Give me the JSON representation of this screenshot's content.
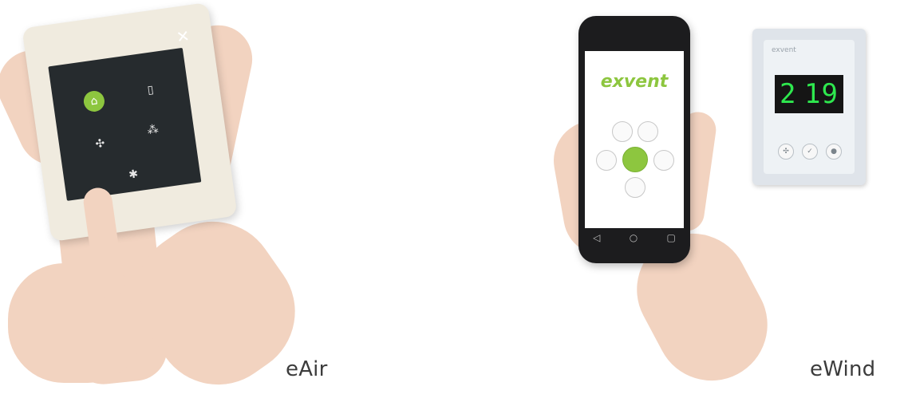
{
  "captions": {
    "left": "eAir",
    "right": "eWind"
  },
  "eair": {
    "screen_title": "",
    "close_glyph": "✕",
    "accent": "#8dc63f"
  },
  "phone": {
    "logo": "exvent"
  },
  "ewind": {
    "brand": "exvent",
    "display_left": "2",
    "display_right": "19",
    "display_color": "#2ee84e"
  }
}
